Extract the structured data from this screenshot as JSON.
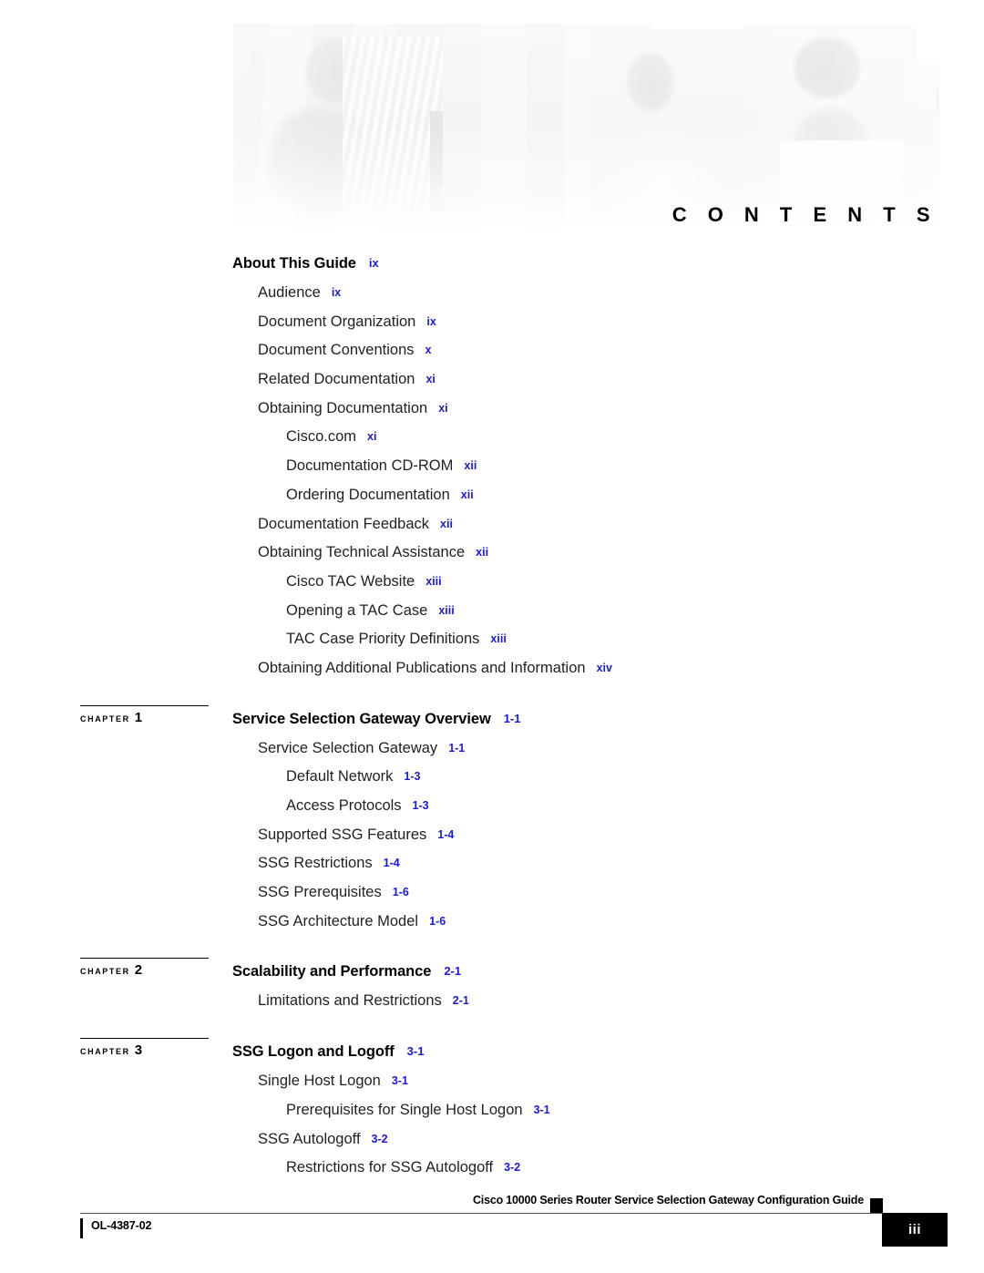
{
  "banner": {
    "title": "C O N T E N T S",
    "title_plain": "CONTENTS",
    "photo_description": "faded grayscale photo banner of people working with networking equipment and laptops"
  },
  "colors": {
    "page_number_blue": "#1a1ae0",
    "text_black": "#231f20",
    "heading_black": "#000000",
    "footer_box": "#000000"
  },
  "toc": {
    "front_matter": {
      "heading": {
        "label": "About This Guide",
        "page": "ix",
        "level": "h"
      },
      "entries": [
        {
          "label": "Audience",
          "page": "ix",
          "level": 1
        },
        {
          "label": "Document Organization",
          "page": "ix",
          "level": 1
        },
        {
          "label": "Document Conventions",
          "page": "x",
          "level": 1
        },
        {
          "label": "Related Documentation",
          "page": "xi",
          "level": 1
        },
        {
          "label": "Obtaining Documentation",
          "page": "xi",
          "level": 1
        },
        {
          "label": "Cisco.com",
          "page": "xi",
          "level": 2
        },
        {
          "label": "Documentation CD-ROM",
          "page": "xii",
          "level": 2
        },
        {
          "label": "Ordering Documentation",
          "page": "xii",
          "level": 2
        },
        {
          "label": "Documentation Feedback",
          "page": "xii",
          "level": 1
        },
        {
          "label": "Obtaining Technical Assistance",
          "page": "xii",
          "level": 1
        },
        {
          "label": "Cisco TAC Website",
          "page": "xiii",
          "level": 2
        },
        {
          "label": "Opening a TAC Case",
          "page": "xiii",
          "level": 2
        },
        {
          "label": "TAC Case Priority Definitions",
          "page": "xiii",
          "level": 2
        },
        {
          "label": "Obtaining Additional Publications and Information",
          "page": "xiv",
          "level": 1
        }
      ]
    },
    "chapters": [
      {
        "marker_word": "CHAPTER",
        "marker_number": "1",
        "heading": {
          "label": "Service Selection Gateway Overview",
          "page": "1-1"
        },
        "entries": [
          {
            "label": "Service Selection Gateway",
            "page": "1-1",
            "level": 1
          },
          {
            "label": "Default Network",
            "page": "1-3",
            "level": 2
          },
          {
            "label": "Access Protocols",
            "page": "1-3",
            "level": 2
          },
          {
            "label": "Supported SSG Features",
            "page": "1-4",
            "level": 1
          },
          {
            "label": "SSG Restrictions",
            "page": "1-4",
            "level": 1
          },
          {
            "label": "SSG Prerequisites",
            "page": "1-6",
            "level": 1
          },
          {
            "label": "SSG Architecture Model",
            "page": "1-6",
            "level": 1
          }
        ]
      },
      {
        "marker_word": "CHAPTER",
        "marker_number": "2",
        "heading": {
          "label": "Scalability and Performance",
          "page": "2-1"
        },
        "entries": [
          {
            "label": "Limitations and Restrictions",
            "page": "2-1",
            "level": 1
          }
        ]
      },
      {
        "marker_word": "CHAPTER",
        "marker_number": "3",
        "heading": {
          "label": "SSG Logon and Logoff",
          "page": "3-1"
        },
        "entries": [
          {
            "label": "Single Host Logon",
            "page": "3-1",
            "level": 1
          },
          {
            "label": "Prerequisites for Single Host Logon",
            "page": "3-1",
            "level": 2
          },
          {
            "label": "SSG Autologoff",
            "page": "3-2",
            "level": 1
          },
          {
            "label": "Restrictions for SSG Autologoff",
            "page": "3-2",
            "level": 2
          }
        ]
      }
    ]
  },
  "footer": {
    "guide_title": "Cisco 10000 Series Router Service Selection Gateway Configuration Guide",
    "page_number": "iii",
    "document_id": "OL-4387-02"
  }
}
